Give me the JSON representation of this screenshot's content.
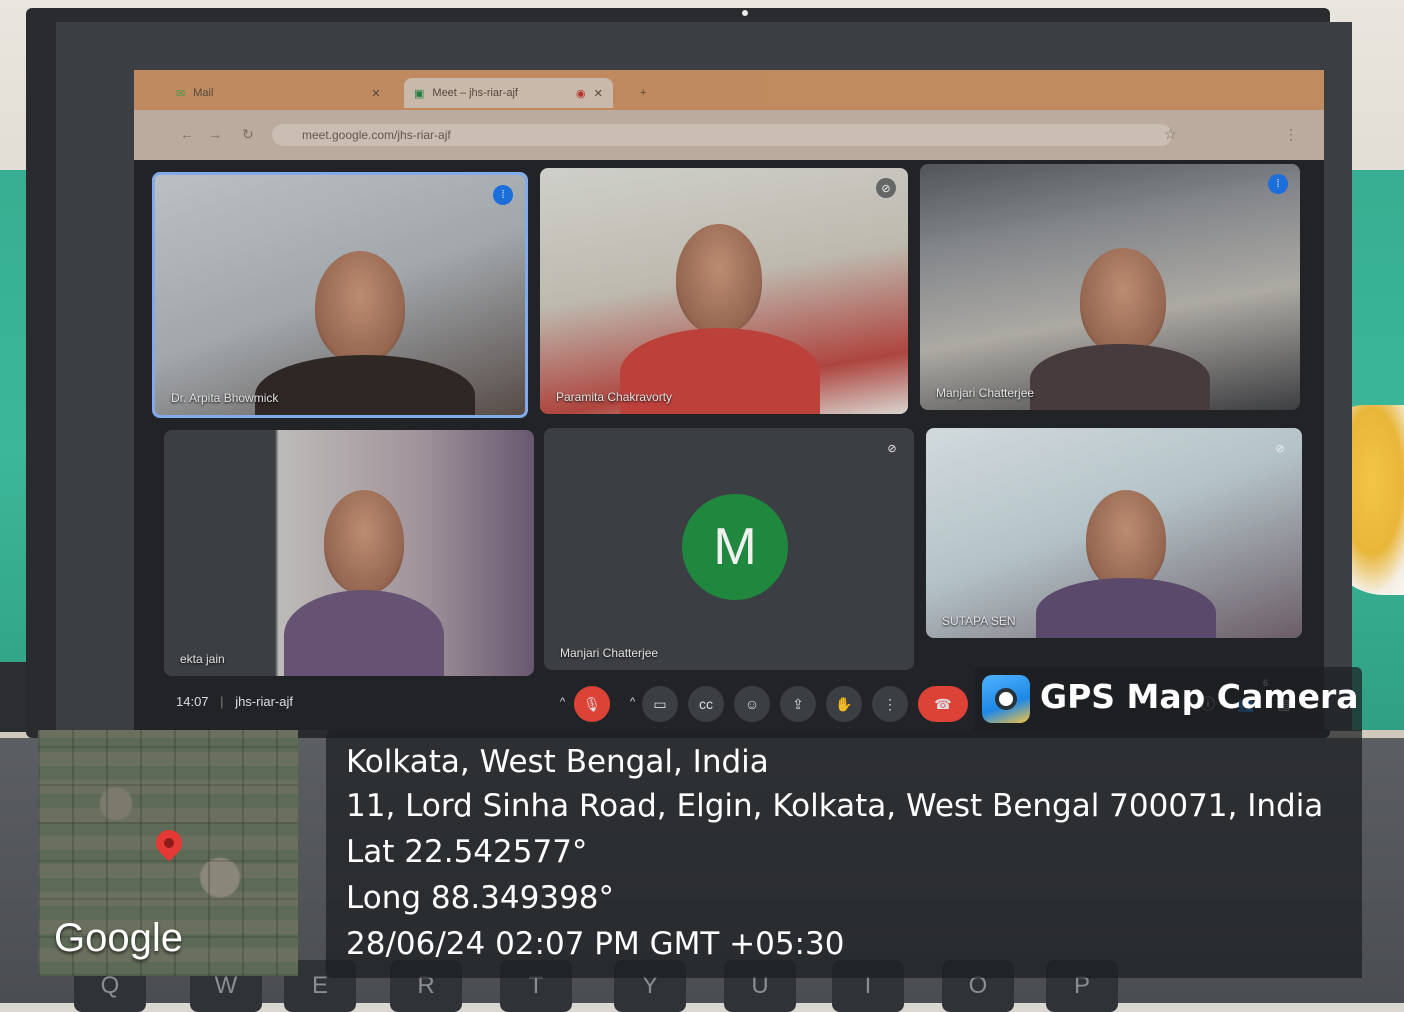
{
  "browser": {
    "tabs": [
      {
        "label": "Mail",
        "active": false
      },
      {
        "label": "Meet – jhs-riar-ajf",
        "active": true
      }
    ],
    "url": "meet.google.com/jhs-riar-ajf"
  },
  "meet": {
    "participants": [
      {
        "name": "Dr. Arpita Bhowmick",
        "mic": "speaking-icon"
      },
      {
        "name": "Paramita Chakravorty",
        "mic": "mic-off-icon"
      },
      {
        "name": "Manjari Chatterjee",
        "mic": "speaking-icon"
      },
      {
        "name": "ekta jain",
        "mic": ""
      },
      {
        "name": "Manjari Chatterjee",
        "mic": "mic-off-icon",
        "avatar_letter": "M"
      },
      {
        "name": "SUTAPA SEN",
        "mic": "mic-off-icon"
      }
    ],
    "time": "14:07",
    "meeting_code": "jhs-riar-ajf",
    "participant_count": "6",
    "separator": "|"
  },
  "gps": {
    "app_name": "GPS Map Camera",
    "place": "Kolkata, West Bengal, India",
    "address": "11, Lord Sinha Road, Elgin, Kolkata, West Bengal 700071, India",
    "lat": "Lat 22.542577°",
    "long": "Long 88.349398°",
    "datetime": "28/06/24 02:07 PM GMT +05:30",
    "map_logo": "Google"
  },
  "keyboard": {
    "keys": [
      "Q",
      "W",
      "E",
      "R",
      "T",
      "Y",
      "U",
      "I",
      "O",
      "P"
    ]
  },
  "colors": {
    "meet_accent": "#8ab4f8",
    "end_call": "#ea4335",
    "avatar": "#1e8e3e",
    "tab_bar": "#e5a067"
  }
}
